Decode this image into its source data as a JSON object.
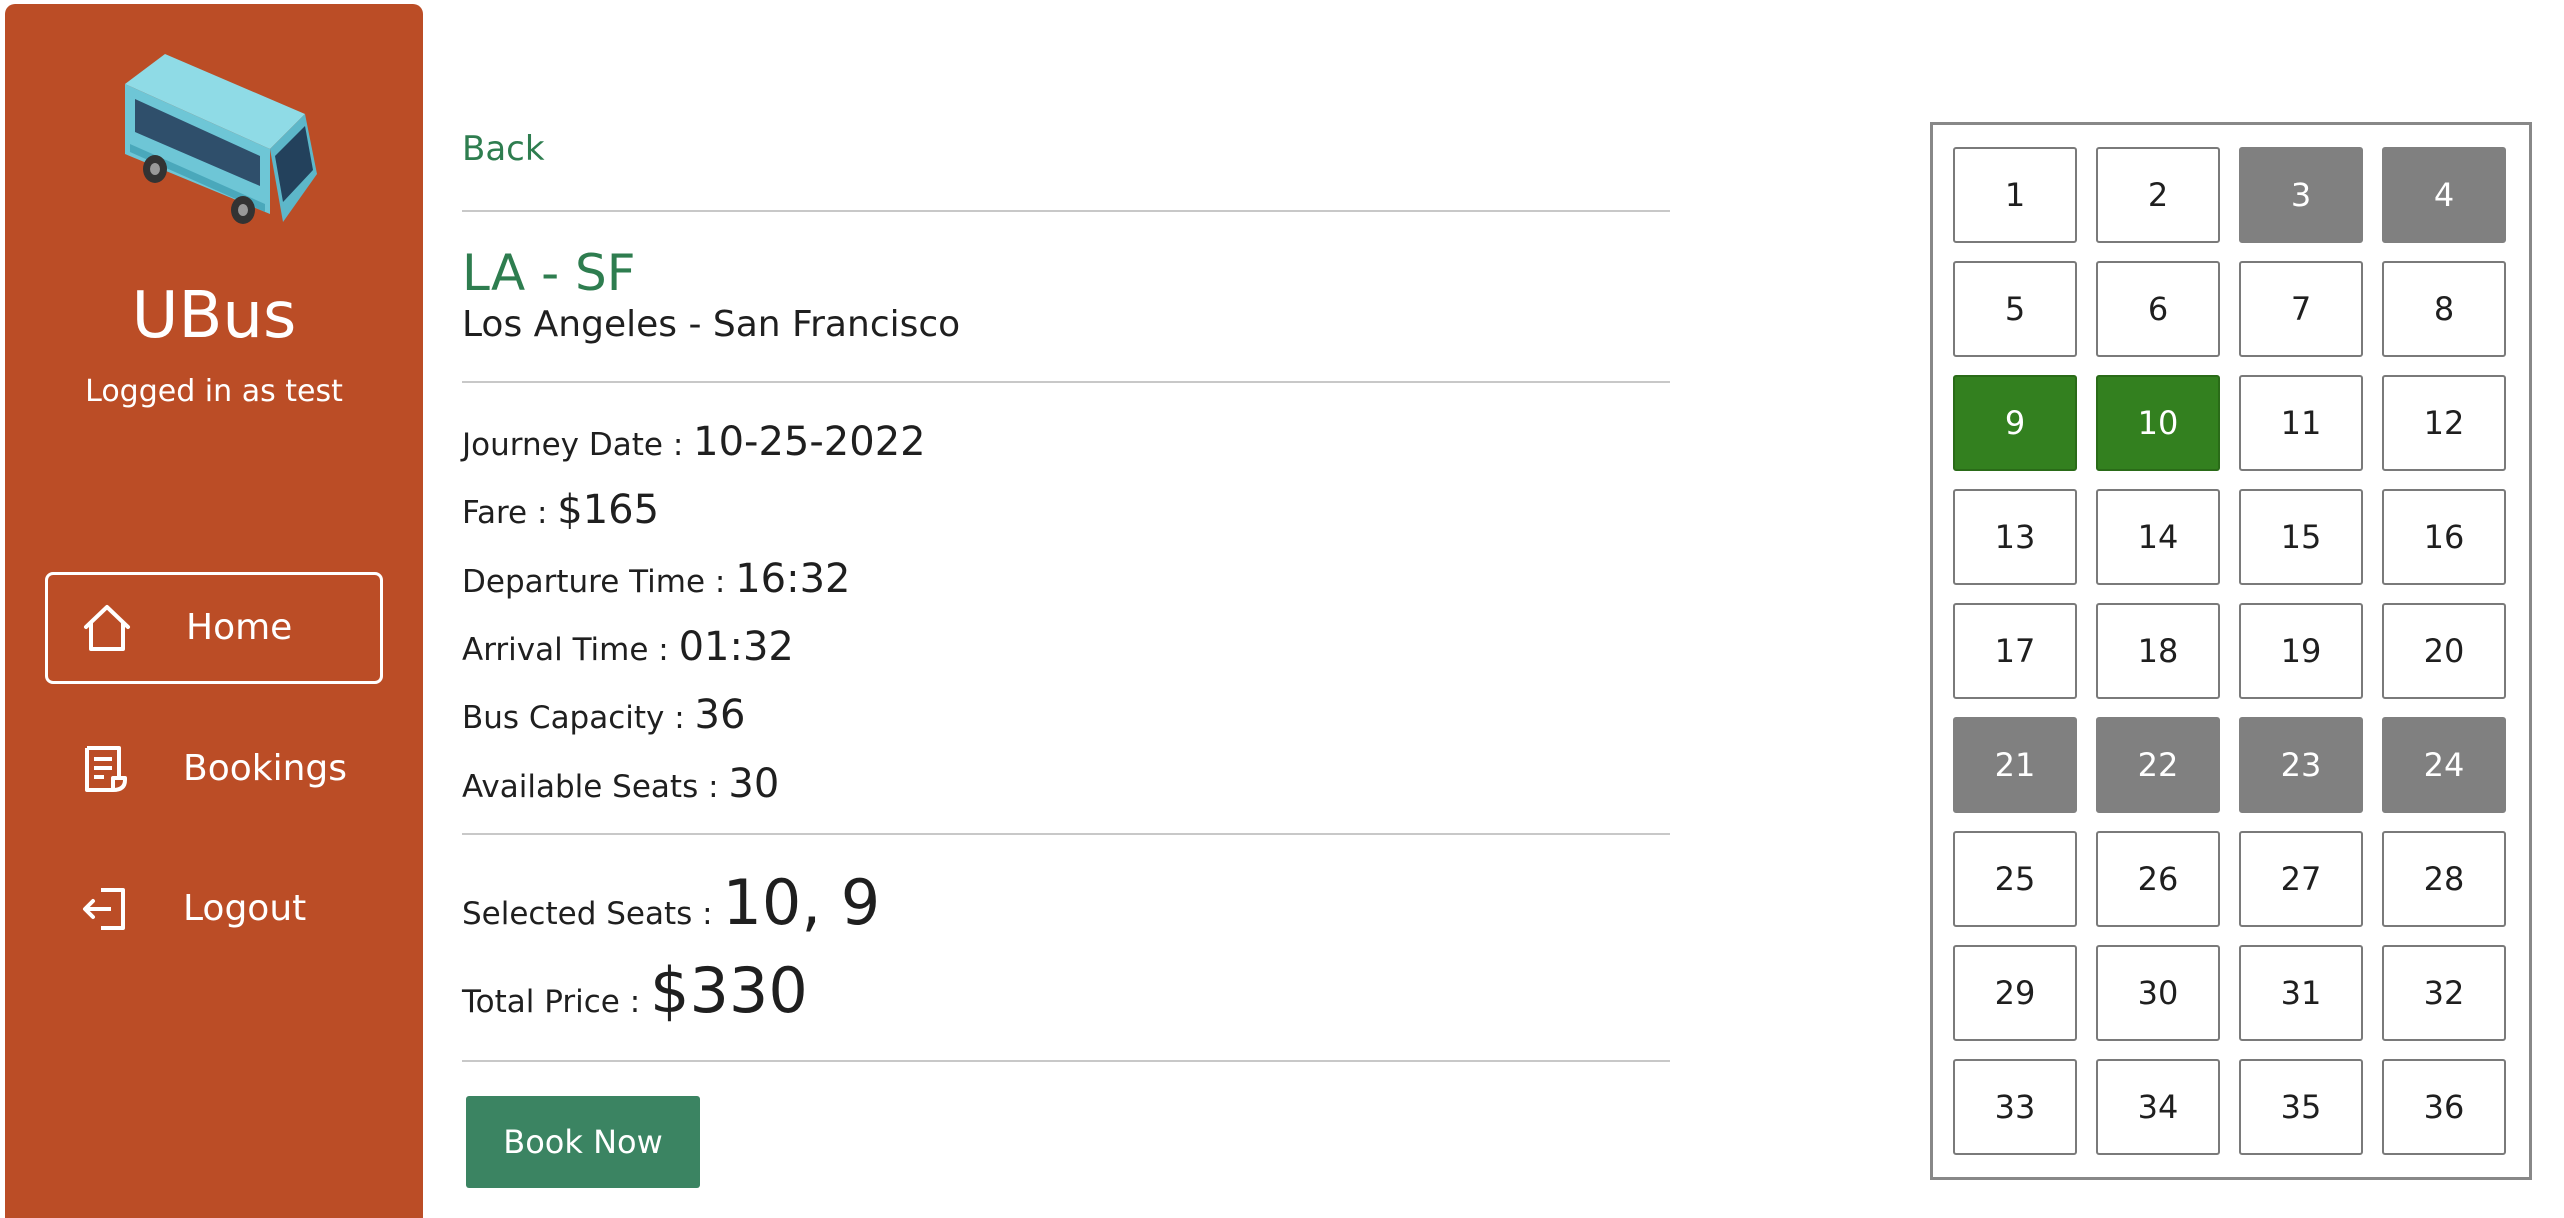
{
  "sidebar": {
    "app_name": "UBus",
    "logged_in": "Logged in as test",
    "nav": [
      {
        "label": "Home",
        "icon": "home-icon",
        "active": true
      },
      {
        "label": "Bookings",
        "icon": "receipt-icon",
        "active": false
      },
      {
        "label": "Logout",
        "icon": "logout-icon",
        "active": false
      }
    ]
  },
  "main": {
    "back_label": "Back",
    "route_code": "LA - SF",
    "route_name": "Los Angeles - San Francisco",
    "info": [
      {
        "label": "Journey Date : ",
        "value": "10-25-2022"
      },
      {
        "label": "Fare : ",
        "value": "$165"
      },
      {
        "label": "Departure Time : ",
        "value": "16:32"
      },
      {
        "label": "Arrival Time : ",
        "value": "01:32"
      },
      {
        "label": "Bus Capacity : ",
        "value": "36"
      },
      {
        "label": "Available Seats : ",
        "value": "30"
      }
    ],
    "summary": [
      {
        "label": "Selected Seats : ",
        "value": "10, 9"
      },
      {
        "label": "Total Price : ",
        "value": "$330"
      }
    ],
    "book_button": "Book Now"
  },
  "seats": {
    "total": 36,
    "booked": [
      3,
      4,
      21,
      22,
      23,
      24
    ],
    "selected": [
      9,
      10
    ]
  },
  "colors": {
    "sidebar": "#bb4d26",
    "accent_green": "#2e7d4f",
    "book_button": "#3b8462",
    "seat_booked": "#808080",
    "seat_selected": "#33801f"
  }
}
